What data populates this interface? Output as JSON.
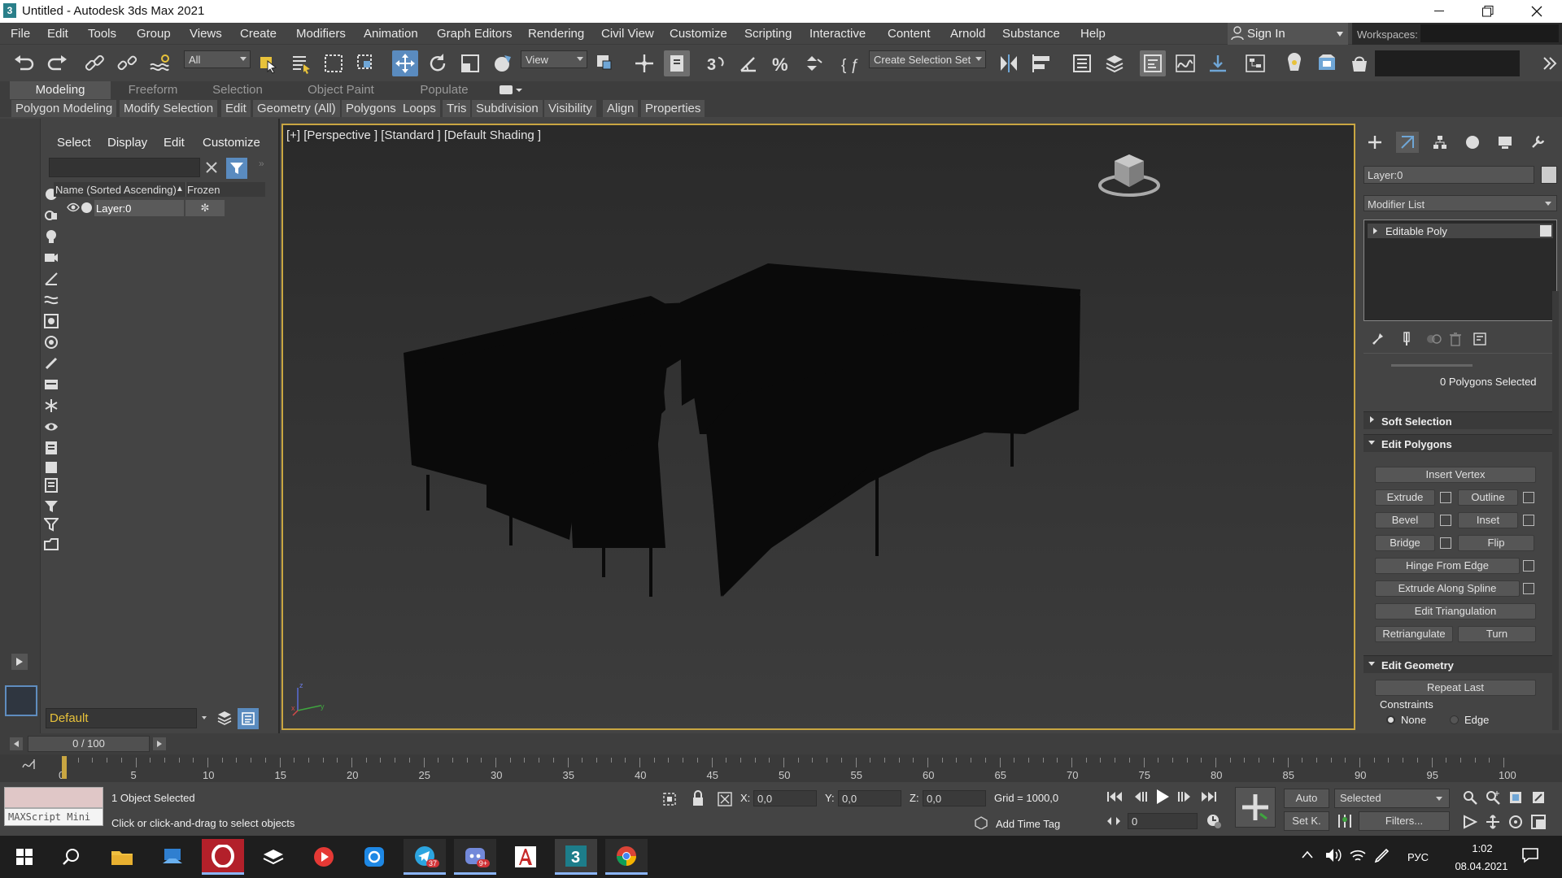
{
  "window": {
    "title": "Untitled - Autodesk 3ds Max 2021",
    "app_icon": "3",
    "controls": [
      "minimize-icon",
      "maximize-icon",
      "close-icon"
    ]
  },
  "menubar": {
    "items": [
      "File",
      "Edit",
      "Tools",
      "Group",
      "Views",
      "Create",
      "Modifiers",
      "Animation",
      "Graph Editors",
      "Rendering",
      "Civil View",
      "Customize",
      "Scripting",
      "Interactive",
      "Content",
      "Arnold",
      "Substance",
      "Help"
    ],
    "sign_in": "Sign In",
    "workspaces_label": "Workspaces:"
  },
  "toolbar": {
    "selection_filter": "All",
    "reference_coord": "View",
    "create_selection_set": "Create Selection Set",
    "icons": [
      "undo-icon",
      "redo-icon",
      "link-icon",
      "unlink-icon",
      "bind-spacewarp-icon",
      "select-object-icon",
      "select-by-name-icon",
      "rect-selection-icon",
      "window-crossing-icon",
      "move-icon",
      "rotate-icon",
      "scale-icon",
      "place-icon",
      "pivot-icon",
      "snap-icon",
      "angle-snap-icon",
      "percent-snap-icon",
      "spinner-snap-icon",
      "edit-named-sets-icon",
      "mirror-icon",
      "align-icon",
      "layer-explorer-icon",
      "toggle-layer-icon",
      "scene-explorer-icon",
      "curve-editor-icon",
      "schematic-view-icon",
      "material-editor-icon",
      "render-setup-icon",
      "rendered-frame-icon",
      "render-icon",
      "expand-icon"
    ]
  },
  "ribbon": {
    "tabs": [
      "Modeling",
      "Freeform",
      "Selection",
      "Object Paint",
      "Populate"
    ],
    "active_tab": "Modeling",
    "subtabs": [
      "Polygon Modeling",
      "Modify Selection",
      "Edit",
      "Geometry (All)",
      "Polygons",
      "Loops",
      "Tris",
      "Subdivision",
      "Visibility",
      "Align",
      "Properties"
    ]
  },
  "scene_explorer": {
    "menu": [
      "Select",
      "Display",
      "Edit",
      "Customize"
    ],
    "search_placeholder": "",
    "columns": [
      "Name (Sorted Ascending)",
      "Frozen"
    ],
    "sort_indicator": "▲",
    "rows": [
      {
        "name": "Layer:0",
        "frozen_icon": "✼"
      }
    ],
    "layer_combo": "Default"
  },
  "viewport": {
    "label": "[+] [Perspective ] [Standard ] [Default Shading ]",
    "axis": {
      "x": "x",
      "y": "y",
      "z": "z"
    }
  },
  "command_panel": {
    "object_name": "Layer:0",
    "modifier_list": "Modifier List",
    "stack": [
      {
        "name": "Editable Poly"
      }
    ],
    "selection_info": "0 Polygons Selected",
    "rollouts": {
      "soft_selection": "Soft Selection",
      "edit_polygons": "Edit Polygons",
      "edit_geometry": "Edit Geometry"
    },
    "buttons": {
      "insert_vertex": "Insert Vertex",
      "extrude": "Extrude",
      "outline": "Outline",
      "bevel": "Bevel",
      "inset": "Inset",
      "bridge": "Bridge",
      "flip": "Flip",
      "hinge": "Hinge From Edge",
      "extrude_spline": "Extrude Along Spline",
      "edit_tri": "Edit Triangulation",
      "retriangulate": "Retriangulate",
      "turn": "Turn",
      "repeat_last": "Repeat Last"
    },
    "constraints": {
      "label": "Constraints",
      "none": "None",
      "edge": "Edge"
    }
  },
  "timeline": {
    "frame_display": "0 / 100",
    "ticks": [
      "0",
      "5",
      "10",
      "15",
      "20",
      "25",
      "30",
      "35",
      "40",
      "45",
      "50",
      "55",
      "60",
      "65",
      "70",
      "75",
      "80",
      "85",
      "90",
      "95",
      "100"
    ],
    "current_frame": 0,
    "total_frames": 100
  },
  "status": {
    "maxscript": "MAXScript Mini",
    "selected": "1 Object Selected",
    "prompt": "Click or click-and-drag to select objects",
    "x_label": "X:",
    "x": "0,0",
    "y_label": "Y:",
    "y": "0,0",
    "z_label": "Z:",
    "z": "0,0",
    "grid": "Grid = 1000,0",
    "add_time_tag": "Add Time Tag",
    "auto": "Auto",
    "set_key": "Set K.",
    "key_filter": "Selected",
    "filters": "Filters...",
    "frame": "0"
  },
  "taskbar": {
    "apps": [
      {
        "icon": "windows-start-icon",
        "badge": ""
      },
      {
        "icon": "search-icon",
        "badge": ""
      },
      {
        "icon": "file-explorer-icon",
        "badge": ""
      },
      {
        "icon": "desktop-app-icon",
        "badge": ""
      },
      {
        "icon": "opera-icon",
        "badge": ""
      },
      {
        "icon": "stack-app-icon",
        "badge": ""
      },
      {
        "icon": "media-player-icon",
        "badge": ""
      },
      {
        "icon": "instagram-icon",
        "badge": ""
      },
      {
        "icon": "telegram-icon",
        "badge": "37"
      },
      {
        "icon": "discord-icon",
        "badge": "9+"
      },
      {
        "icon": "autocad-icon",
        "badge": ""
      },
      {
        "icon": "3dsmax-icon",
        "badge": ""
      },
      {
        "icon": "chrome-icon",
        "badge": ""
      }
    ],
    "lang": "РУС",
    "time": "1:02",
    "date": "08.04.2021"
  },
  "colors": {
    "accent": "#5a8bbf",
    "viewport_border": "#c9a642",
    "layer_combo_text": "#e8c23a"
  }
}
